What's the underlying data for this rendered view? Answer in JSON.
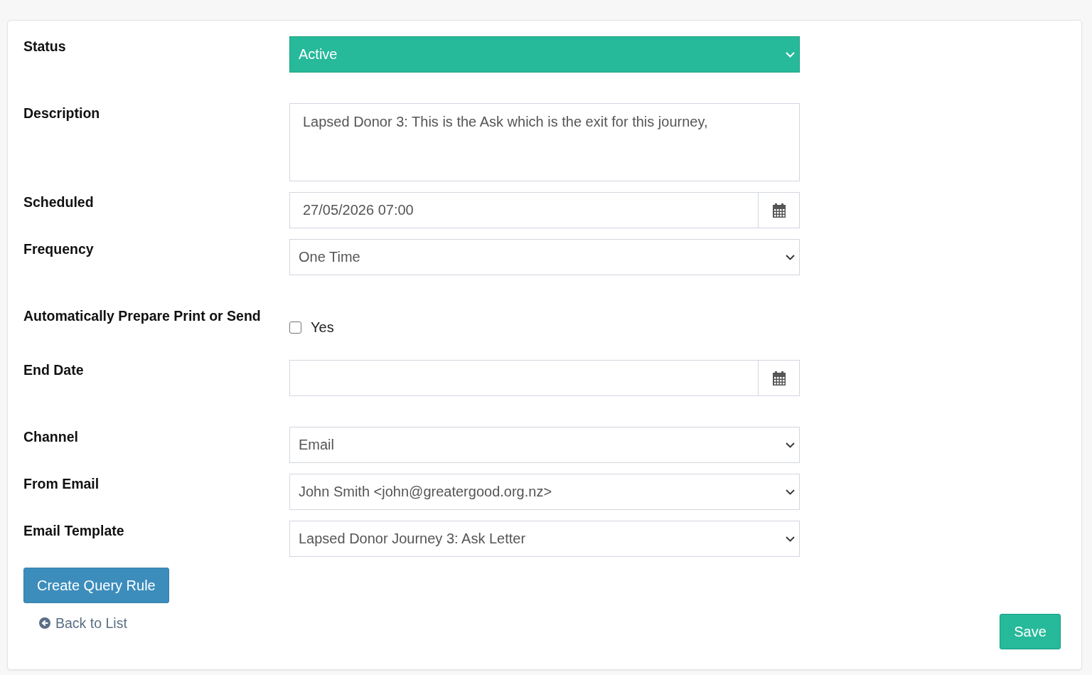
{
  "form": {
    "fields": [
      {
        "kind": "status",
        "label": "Status",
        "value": "Active"
      },
      {
        "kind": "textarea",
        "label": "Description",
        "value": "Lapsed Donor 3: This is the Ask which is the exit for this journey,"
      },
      {
        "kind": "date",
        "label": "Scheduled",
        "value": "27/05/2026 07:00"
      },
      {
        "kind": "select",
        "label": "Frequency",
        "value": "One Time"
      },
      {
        "kind": "checkbox",
        "label": "Automatically Prepare Print or Send",
        "option": "Yes",
        "checked": false
      },
      {
        "kind": "date",
        "label": "End Date"
      },
      {
        "kind": "select",
        "label": "Channel",
        "value": "Email"
      },
      {
        "kind": "select",
        "label": "From Email",
        "value": "John Smith <john@greatergood.org.nz>"
      },
      {
        "kind": "select",
        "label": "Email Template",
        "value": "Lapsed Donor Journey 3: Ask Letter"
      }
    ],
    "create_query_rule_button": {
      "label": "Create Query Rule"
    },
    "back_link": {
      "label": "Back to List"
    },
    "save_button": {
      "label": "Save"
    }
  }
}
